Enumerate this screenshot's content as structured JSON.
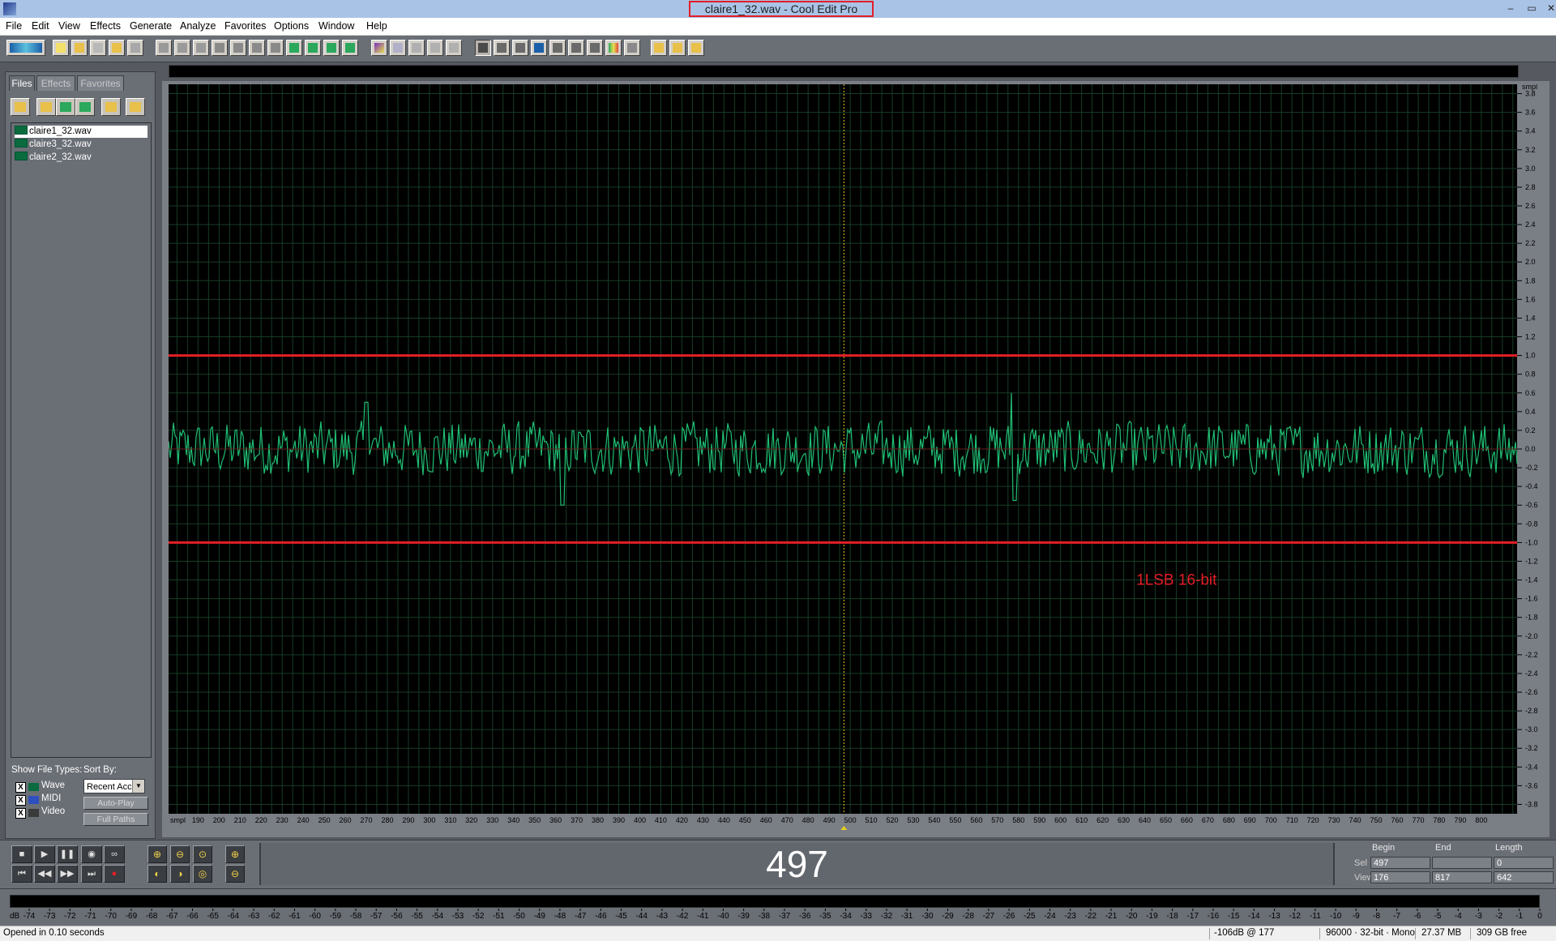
{
  "window": {
    "title": "claire1_32.wav - Cool Edit Pro",
    "controls": [
      "–",
      "▭",
      "✕"
    ]
  },
  "menu": [
    "File",
    "Edit",
    "View",
    "Effects",
    "Generate",
    "Analyze",
    "Favorites",
    "Options",
    "Window",
    "Help"
  ],
  "left_panel": {
    "tabs": [
      "Files",
      "Effects",
      "Favorites"
    ],
    "active_tab": "Files",
    "files": [
      "claire1_32.wav",
      "claire3_32.wav",
      "claire2_32.wav"
    ],
    "selected_file": "claire1_32.wav",
    "show_file_types_label": "Show File Types:",
    "sort_by_label": "Sort By:",
    "sort_by_value": "Recent Acc",
    "file_types": [
      {
        "label": "Wave",
        "checked": "X"
      },
      {
        "label": "MIDI",
        "checked": "X"
      },
      {
        "label": "Video",
        "checked": "X"
      }
    ],
    "auto_play_label": "Auto-Play",
    "full_paths_label": "Full Paths"
  },
  "waveform": {
    "y_unit": "smpl",
    "x_unit": "smpl",
    "y_ticks": [
      "3.8",
      "3.6",
      "3.4",
      "3.2",
      "3.0",
      "2.8",
      "2.6",
      "2.4",
      "2.2",
      "2.0",
      "1.8",
      "1.6",
      "1.4",
      "1.2",
      "1.0",
      "0.8",
      "0.6",
      "0.4",
      "0.2",
      "0.0",
      "-0.2",
      "-0.4",
      "-0.6",
      "-0.8",
      "-1.0",
      "-1.2",
      "-1.4",
      "-1.6",
      "-1.8",
      "-2.0",
      "-2.2",
      "-2.4",
      "-2.6",
      "-2.8",
      "-3.0",
      "-3.2",
      "-3.4",
      "-3.6",
      "-3.8"
    ],
    "x_ticks": [
      "190",
      "200",
      "210",
      "220",
      "230",
      "240",
      "250",
      "260",
      "270",
      "280",
      "290",
      "300",
      "310",
      "320",
      "330",
      "340",
      "350",
      "360",
      "370",
      "380",
      "390",
      "400",
      "410",
      "420",
      "430",
      "440",
      "450",
      "460",
      "470",
      "480",
      "490",
      "500",
      "510",
      "520",
      "530",
      "540",
      "550",
      "560",
      "570",
      "580",
      "590",
      "600",
      "610",
      "620",
      "630",
      "640",
      "650",
      "660",
      "670",
      "680",
      "690",
      "700",
      "710",
      "720",
      "730",
      "740",
      "750",
      "760",
      "770",
      "780",
      "790",
      "800"
    ],
    "view_range": [
      176,
      817
    ],
    "amplitude_range": [
      -3.9,
      3.9
    ],
    "cursor_position": 497,
    "annotation_lines": [
      1.0,
      -1.0
    ],
    "annotation_text": "1LSB  16-bit",
    "wave_color": "#1fbf74",
    "annotation_color": "#e41e26",
    "grid_color": "#173d26",
    "background": "#000000"
  },
  "transport": {
    "time_display": "497",
    "sel_label": "Sel",
    "view_label": "View",
    "begin_label": "Begin",
    "end_label": "End",
    "length_label": "Length",
    "sel_begin": "497",
    "sel_end": "",
    "sel_length": "0",
    "view_begin": "176",
    "view_end": "817",
    "view_length": "642"
  },
  "level_meter": {
    "unit_label": "dB",
    "ticks": [
      "-74",
      "-73",
      "-72",
      "-71",
      "-70",
      "-69",
      "-68",
      "-67",
      "-66",
      "-65",
      "-64",
      "-63",
      "-62",
      "-61",
      "-60",
      "-59",
      "-58",
      "-57",
      "-56",
      "-55",
      "-54",
      "-53",
      "-52",
      "-51",
      "-50",
      "-49",
      "-48",
      "-47",
      "-46",
      "-45",
      "-44",
      "-43",
      "-42",
      "-41",
      "-40",
      "-39",
      "-38",
      "-37",
      "-36",
      "-35",
      "-34",
      "-33",
      "-32",
      "-31",
      "-30",
      "-29",
      "-28",
      "-27",
      "-26",
      "-25",
      "-24",
      "-23",
      "-22",
      "-21",
      "-20",
      "-19",
      "-18",
      "-17",
      "-16",
      "-15",
      "-14",
      "-13",
      "-12",
      "-11",
      "-10",
      "-9",
      "-8",
      "-7",
      "-6",
      "-5",
      "-4",
      "-3",
      "-2",
      "-1",
      "0"
    ]
  },
  "status": {
    "message": "Opened in 0.10 seconds",
    "level": "-106dB @ 177",
    "format": "96000 · 32-bit · Mono",
    "size": "27.37 MB",
    "free": "309 GB free"
  }
}
